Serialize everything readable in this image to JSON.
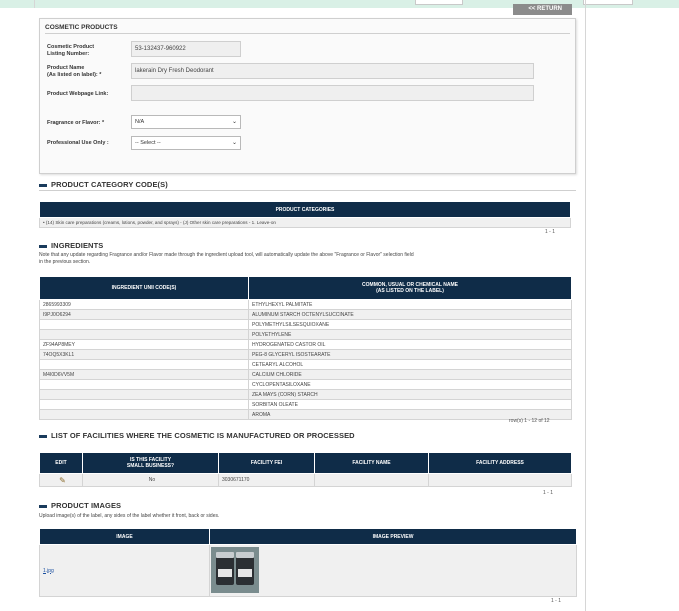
{
  "header": {
    "return_label": "<< RETURN"
  },
  "cosmetic_products": {
    "legend": "COSMETIC PRODUCTS",
    "listing_number_label_1": "Cosmetic Product",
    "listing_number_label_2": "Listing Number:",
    "listing_number_value": "53-132437-960922",
    "product_name_label_1": "Product Name",
    "product_name_label_2": "(As listed on label): *",
    "product_name_value": "lakerain Dry Fresh Deodorant",
    "webpage_label": "Product Webpage Link:",
    "webpage_value": "",
    "fragrance_label": "Fragrance or Flavor: *",
    "fragrance_value": "N/A",
    "professional_label": "Professional Use Only :",
    "professional_value": "-- Select --"
  },
  "category_section": {
    "title": "PRODUCT CATEGORY CODE(S)",
    "header": "PRODUCT CATEGORIES",
    "rows": [
      "• (14) Skin care preparations (creams, lotions, powder, and sprays) - (J) Other skin care preparations - 1. Leave-on"
    ],
    "pager": "1 - 1"
  },
  "ingredients_section": {
    "title": "INGREDIENTS",
    "note_1": "Note that any update regarding Fragrance and/or Flavor made through the ingredient upload tool, will automatically update the above \"Fragrance or Flavor\" selection field",
    "note_2": "in the previous section.",
    "col_unii": "INGREDIENT UNII CODE(S)",
    "col_name_1": "COMMON, USUAL OR CHEMICAL NAME",
    "col_name_2": "(AS LISTED ON THE LABEL)",
    "rows": [
      {
        "unii": "2865993309",
        "name": "ETHYLHEXYL PALMITATE"
      },
      {
        "unii": "I9PJ0O6294",
        "name": "ALUMINUM STARCH OCTENYLSUCCINATE"
      },
      {
        "unii": "",
        "name": "POLYMETHYLSILSESQUIOXANE"
      },
      {
        "unii": "",
        "name": "POLYETHYLENE"
      },
      {
        "unii": "ZF94AP8MEY",
        "name": "HYDROGENATED CASTOR OIL"
      },
      {
        "unii": "74OQ5X3KL1",
        "name": "PEG-8 GLYCERYL ISOSTEARATE"
      },
      {
        "unii": "",
        "name": "CETEARYL ALCOHOL"
      },
      {
        "unii": "M4I0D6VV5M",
        "name": "CALCIUM CHLORIDE"
      },
      {
        "unii": "",
        "name": "CYCLOPENTASILOXANE"
      },
      {
        "unii": "",
        "name": "ZEA MAYS (CORN) STARCH"
      },
      {
        "unii": "",
        "name": "SORBITAN OLEATE"
      },
      {
        "unii": "",
        "name": "AROMA"
      }
    ],
    "pager": "row(s) 1 - 12 of 12"
  },
  "facilities_section": {
    "title": "LIST OF FACILITIES WHERE THE COSMETIC IS MANUFACTURED OR PROCESSED",
    "col_edit": "EDIT",
    "col_small_1": "IS THIS FACILITY",
    "col_small_2": "SMALL BUSINESS?",
    "col_fei": "FACILITY FEI",
    "col_name": "FACILITY NAME",
    "col_address": "FACILITY ADDRESS",
    "rows": [
      {
        "small_business": "No",
        "fei": "3030671170",
        "name": "",
        "address": ""
      }
    ],
    "pager": "1 - 1"
  },
  "images_section": {
    "title": "PRODUCT IMAGES",
    "note": "Upload image(s) of the label, any sides of the label whether it front, back or sides.",
    "col_image": "IMAGE",
    "col_preview": "IMAGE PREVIEW",
    "rows": [
      {
        "file": "1.jpg"
      }
    ],
    "pager": "1 - 1"
  },
  "icons": {
    "edit": "pencil-icon",
    "section_bullet": "minus-bar-icon",
    "select_caret": "chevron-down-icon"
  },
  "colors": {
    "table_header": "#0f2c48",
    "topbar": "#d9f0e6",
    "link": "#1a4fa0"
  }
}
